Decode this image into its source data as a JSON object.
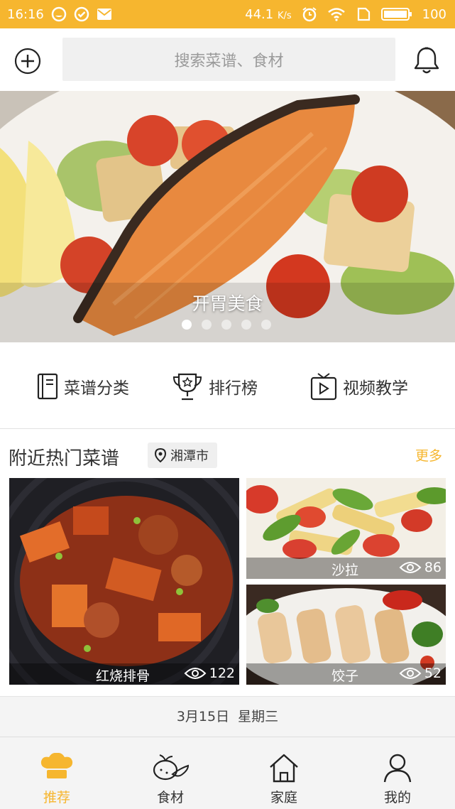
{
  "status_bar": {
    "time": "16:16",
    "speed": "44.1",
    "speed_unit": "K/s",
    "battery": "100",
    "icons": [
      "app-icon",
      "check-icon",
      "mail-icon",
      "alarm-icon",
      "wifi-icon",
      "sim-icon",
      "battery-icon"
    ]
  },
  "header": {
    "search_placeholder": "搜索菜谱、食材",
    "add_icon": "plus-circle-icon",
    "bell_icon": "bell-icon"
  },
  "banner": {
    "caption": "开胃美食",
    "slide_count": 5,
    "active_slide": 0
  },
  "quick_nav": [
    {
      "label": "菜谱分类",
      "icon": "recipe-book-icon"
    },
    {
      "label": "排行榜",
      "icon": "trophy-icon"
    },
    {
      "label": "视频教学",
      "icon": "video-tv-icon"
    }
  ],
  "hot_section": {
    "title": "附近热门菜谱",
    "location": "湘潭市",
    "more": "更多",
    "cards": [
      {
        "name": "红烧排骨",
        "views": "122"
      },
      {
        "name": "沙拉",
        "views": "86"
      },
      {
        "name": "饺子",
        "views": "52"
      }
    ]
  },
  "date_bar": {
    "date": "3月15日",
    "weekday": "星期三"
  },
  "bottom_nav": [
    {
      "label": "推荐",
      "icon": "chef-hat-icon",
      "active": true
    },
    {
      "label": "食材",
      "icon": "vegetables-icon",
      "active": false
    },
    {
      "label": "家庭",
      "icon": "home-icon",
      "active": false
    },
    {
      "label": "我的",
      "icon": "user-icon",
      "active": false
    }
  ],
  "colors": {
    "accent": "#f6b62f",
    "status_bar": "#f6b62f",
    "text": "#333333",
    "search_bg": "#f0f0f0"
  }
}
